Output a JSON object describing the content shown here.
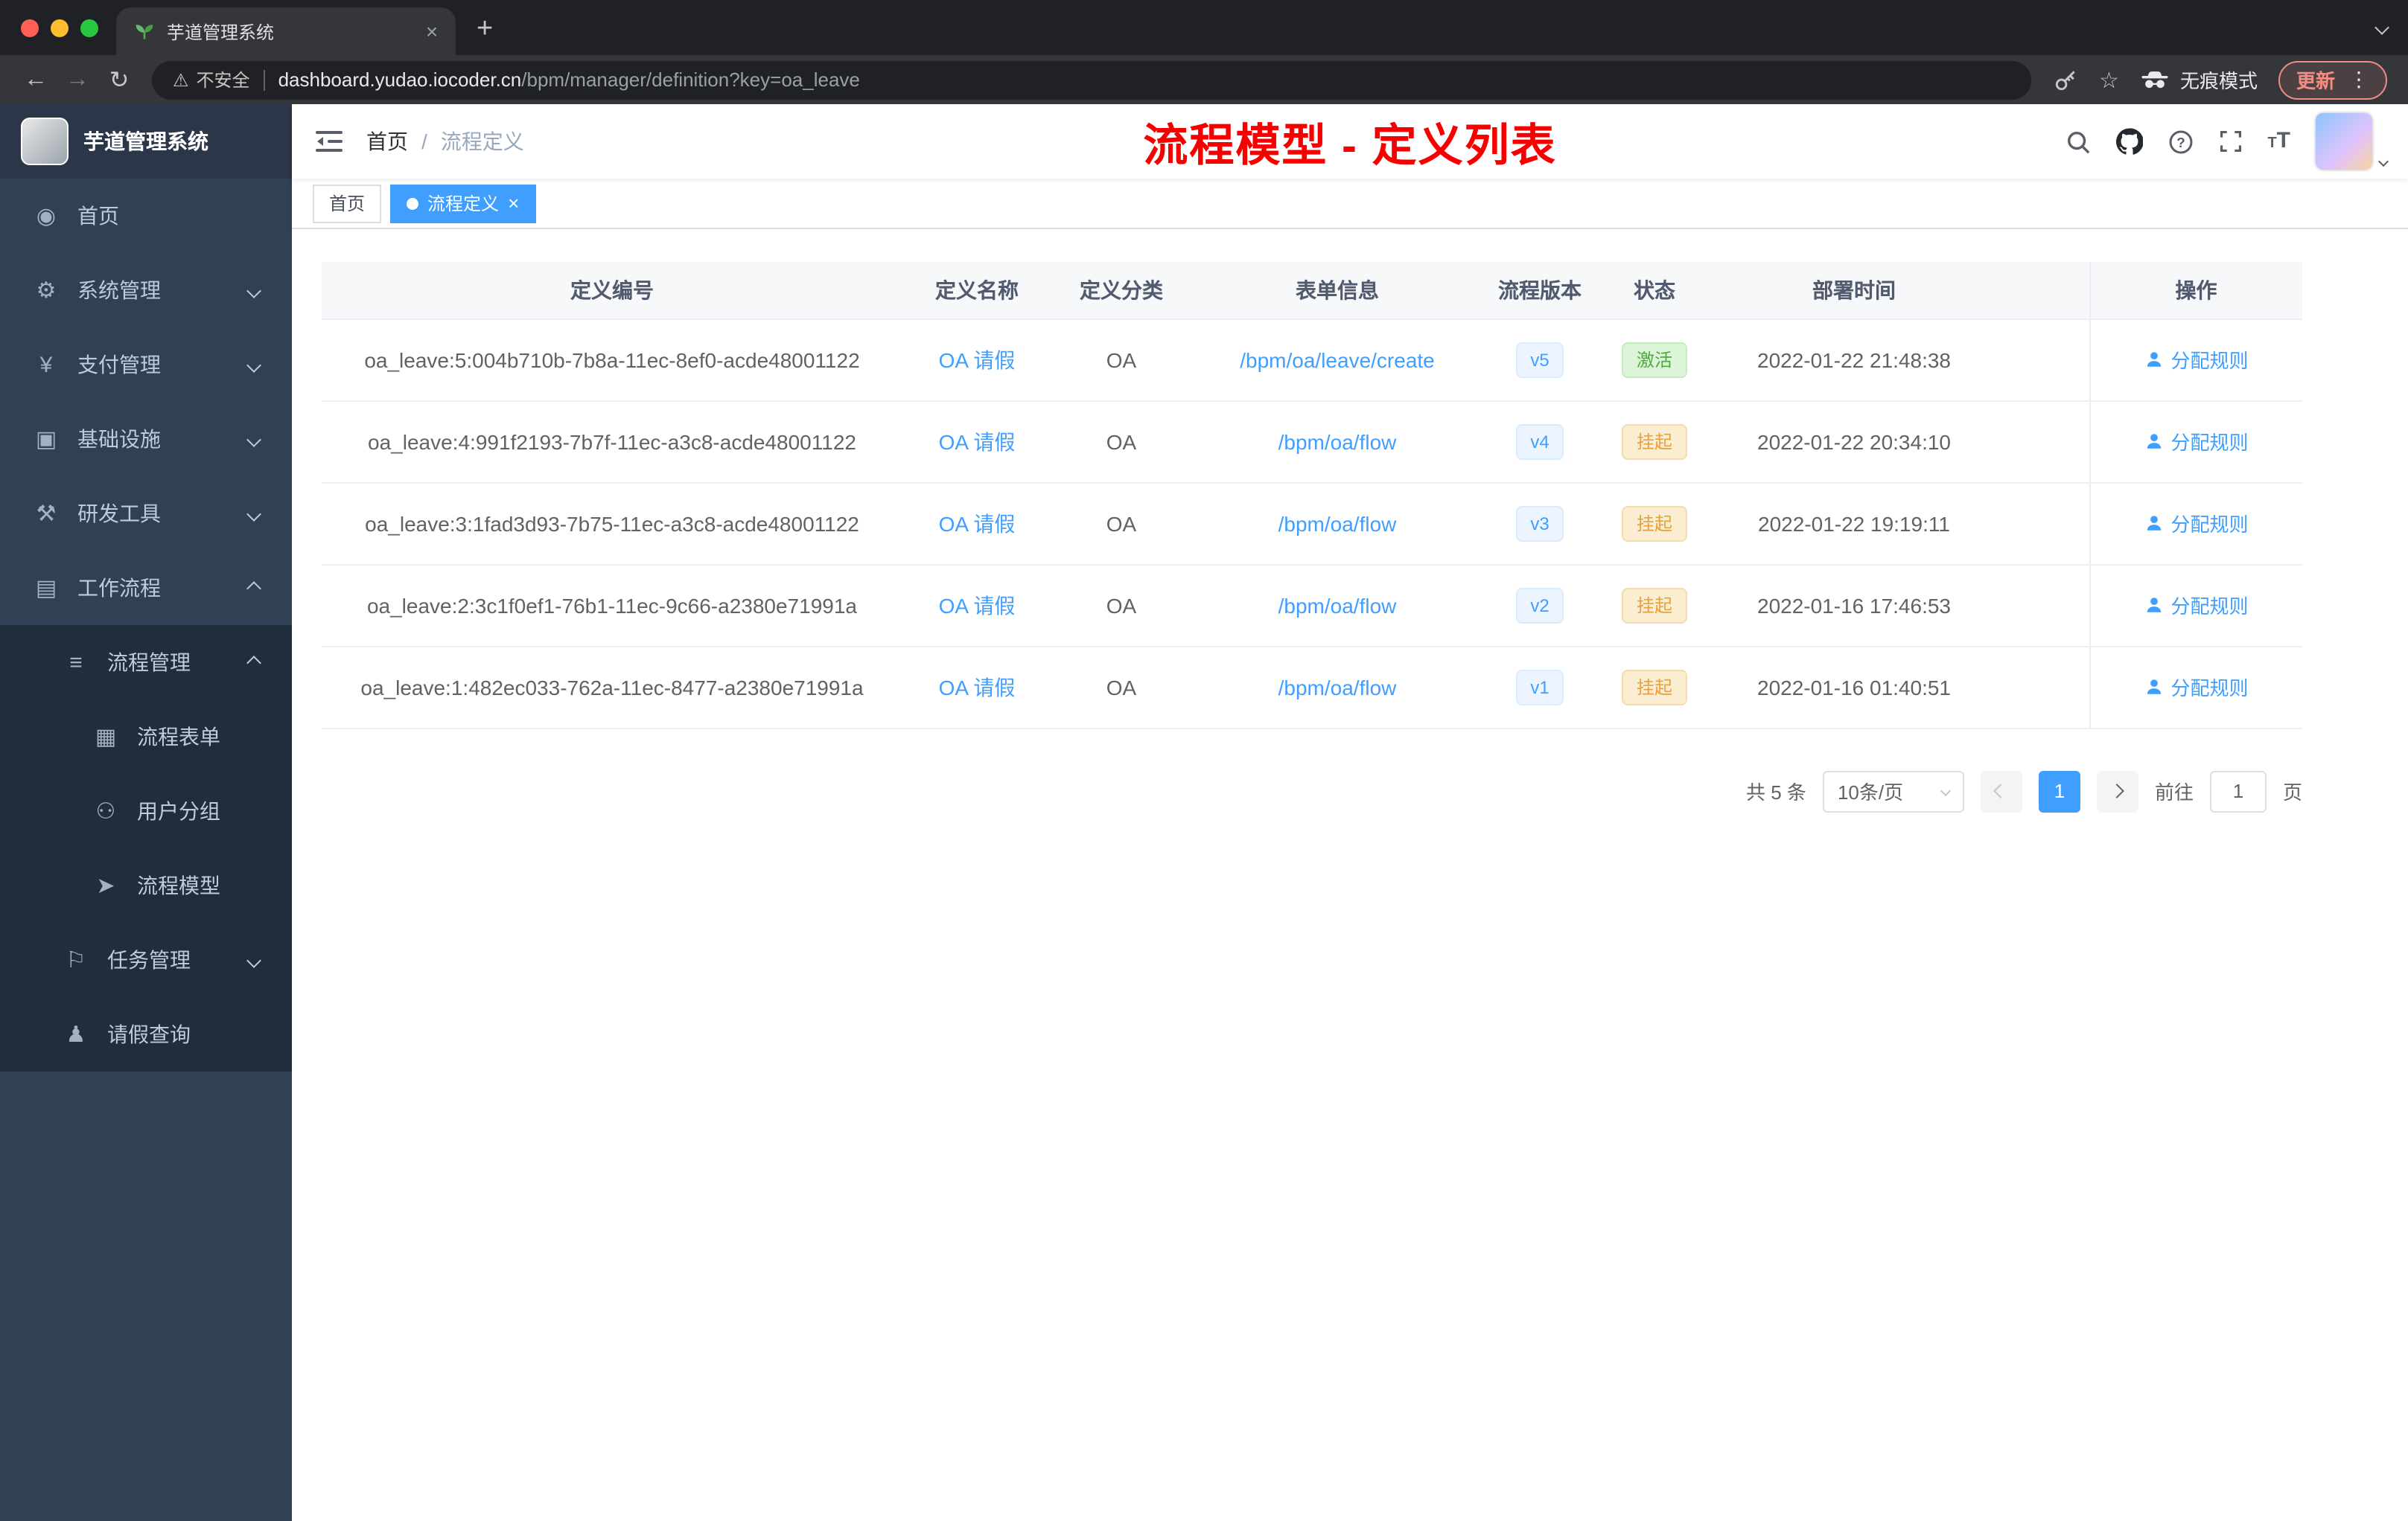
{
  "colors": {
    "accent": "#409eff",
    "success": "#4faa3c",
    "warning": "#e6a23c",
    "sidebar_bg": "#304156",
    "annotation_red": "#f80000"
  },
  "browser": {
    "tab_title": "芋道管理系统",
    "security_label": "不安全",
    "url_host": "dashboard.yudao.iocoder.cn",
    "url_path": "/bpm/manager/definition?key=oa_leave",
    "incognito_label": "无痕模式",
    "update_label": "更新"
  },
  "icons": {
    "tab_close": "×",
    "new_tab": "+",
    "back": "←",
    "forward": "→",
    "reload": "↻",
    "star": "☆",
    "dots": "⋮",
    "warning": "⚠"
  },
  "sidebar": {
    "logo_title": "芋道管理系统",
    "items": [
      {
        "name": "home",
        "label": "首页",
        "glyph": "◉"
      },
      {
        "name": "system",
        "label": "系统管理",
        "glyph": "⚙"
      },
      {
        "name": "payment",
        "label": "支付管理",
        "glyph": "¥"
      },
      {
        "name": "infrastructure",
        "label": "基础设施",
        "glyph": "▣"
      },
      {
        "name": "devtools",
        "label": "研发工具",
        "glyph": "⚒"
      },
      {
        "name": "workflow",
        "label": "工作流程",
        "glyph": "▤"
      },
      {
        "name": "process-mgmt",
        "label": "流程管理",
        "glyph": "≡"
      },
      {
        "name": "process-form",
        "label": "流程表单",
        "glyph": "▦"
      },
      {
        "name": "user-group",
        "label": "用户分组",
        "glyph": "⚇"
      },
      {
        "name": "process-model",
        "label": "流程模型",
        "glyph": "➤"
      },
      {
        "name": "task-mgmt",
        "label": "任务管理",
        "glyph": "⚐"
      },
      {
        "name": "leave-query",
        "label": "请假查询",
        "glyph": "♟"
      }
    ]
  },
  "header": {
    "breadcrumb_root": "首页",
    "breadcrumb_separator": "/",
    "breadcrumb_current": "流程定义",
    "annotation": "流程模型 - 定义列表"
  },
  "tags": {
    "home": "首页",
    "active": "流程定义"
  },
  "table": {
    "columns": [
      "定义编号",
      "定义名称",
      "定义分类",
      "表单信息",
      "流程版本",
      "状态",
      "部署时间",
      "操作"
    ],
    "action_label": "分配规则",
    "rows": [
      {
        "id": "oa_leave:5:004b710b-7b8a-11ec-8ef0-acde48001122",
        "name": "OA 请假",
        "category": "OA",
        "form": "/bpm/oa/leave/create",
        "version": "v5",
        "status": "激活",
        "status_variant": "success",
        "time": "2022-01-22 21:48:38"
      },
      {
        "id": "oa_leave:4:991f2193-7b7f-11ec-a3c8-acde48001122",
        "name": "OA 请假",
        "category": "OA",
        "form": "/bpm/oa/flow",
        "version": "v4",
        "status": "挂起",
        "status_variant": "warning",
        "time": "2022-01-22 20:34:10"
      },
      {
        "id": "oa_leave:3:1fad3d93-7b75-11ec-a3c8-acde48001122",
        "name": "OA 请假",
        "category": "OA",
        "form": "/bpm/oa/flow",
        "version": "v3",
        "status": "挂起",
        "status_variant": "warning",
        "time": "2022-01-22 19:19:11"
      },
      {
        "id": "oa_leave:2:3c1f0ef1-76b1-11ec-9c66-a2380e71991a",
        "name": "OA 请假",
        "category": "OA",
        "form": "/bpm/oa/flow",
        "version": "v2",
        "status": "挂起",
        "status_variant": "warning",
        "time": "2022-01-16 17:46:53"
      },
      {
        "id": "oa_leave:1:482ec033-762a-11ec-8477-a2380e71991a",
        "name": "OA 请假",
        "category": "OA",
        "form": "/bpm/oa/flow",
        "version": "v1",
        "status": "挂起",
        "status_variant": "warning",
        "time": "2022-01-16 01:40:51"
      }
    ]
  },
  "pagination": {
    "total_label": "共 5 条",
    "page_size_label": "10条/页",
    "current_page": "1",
    "goto_label": "前往",
    "goto_value": "1",
    "page_unit": "页"
  }
}
